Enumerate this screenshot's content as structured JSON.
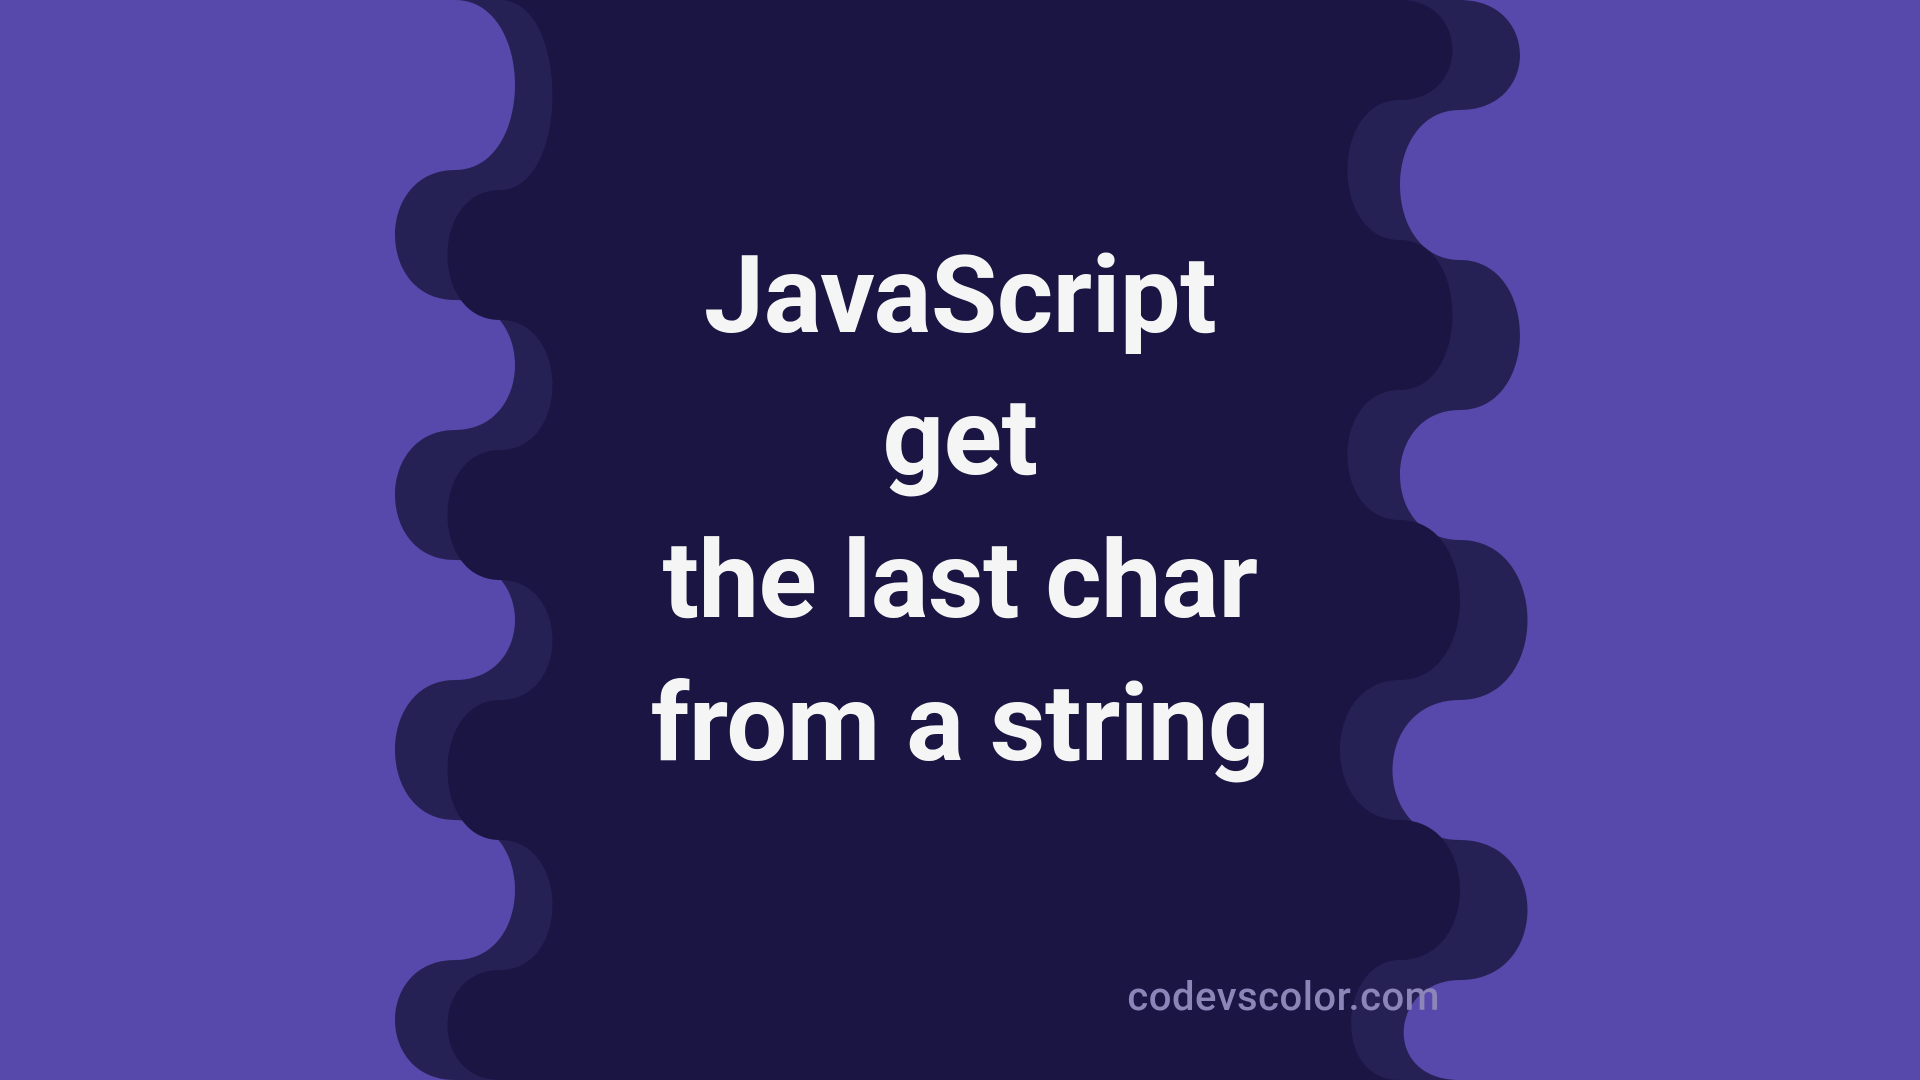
{
  "title": {
    "line1": "JavaScript",
    "line2": "get",
    "line3": "the last char",
    "line4": "from a string"
  },
  "attribution": "codevscolor.com",
  "colors": {
    "bg_outer": "#5649ab",
    "bg_mid": "#262155",
    "bg_inner": "#1a1542",
    "text": "#f5f5f5",
    "attribution": "#8c86b8"
  }
}
